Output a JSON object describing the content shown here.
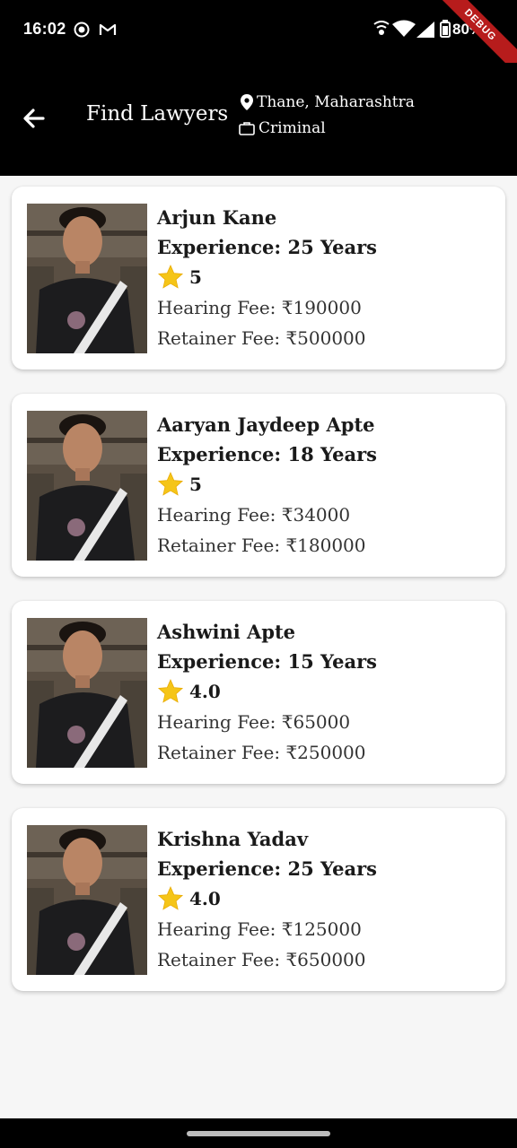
{
  "status_bar": {
    "time": "16:02",
    "battery": "80%",
    "debug_label": "DEBUG"
  },
  "app_bar": {
    "title": "Find Lawyers",
    "location": "Thane, Maharashtra",
    "category": "Criminal"
  },
  "lawyers": [
    {
      "name": "Arjun Kane",
      "experience": "Experience: 25 Years",
      "rating": "5",
      "hearing_fee": "Hearing Fee: ₹190000",
      "retainer_fee": "Retainer Fee: ₹500000"
    },
    {
      "name": "Aaryan Jaydeep Apte",
      "experience": "Experience: 18 Years",
      "rating": "5",
      "hearing_fee": "Hearing Fee: ₹34000",
      "retainer_fee": "Retainer Fee: ₹180000"
    },
    {
      "name": "Ashwini Apte",
      "experience": "Experience: 15 Years",
      "rating": "4.0",
      "hearing_fee": "Hearing Fee: ₹65000",
      "retainer_fee": "Retainer Fee: ₹250000"
    },
    {
      "name": "Krishna Yadav",
      "experience": "Experience: 25 Years",
      "rating": "4.0",
      "hearing_fee": "Hearing Fee: ₹125000",
      "retainer_fee": "Retainer Fee: ₹650000"
    }
  ],
  "colors": {
    "app_bar": "#000000",
    "background": "#f6f6f6",
    "card": "#ffffff",
    "star": "#f5c518",
    "debug_ribbon": "#b71c1c"
  },
  "icons": [
    "back-arrow-icon",
    "location-pin-icon",
    "briefcase-icon",
    "star-icon"
  ]
}
